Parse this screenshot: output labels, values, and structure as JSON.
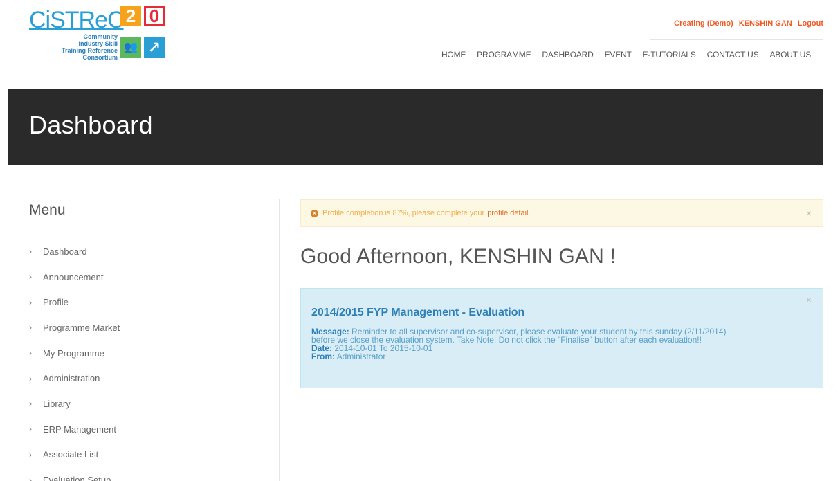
{
  "logo": {
    "word": "CiSTReC",
    "two": "2",
    "zero": "0",
    "sub_lines": [
      "Community",
      "Industry Skill",
      "Training Reference",
      "Consortium"
    ]
  },
  "topbar": {
    "creating": "Creating (Demo)",
    "user": "KENSHIN GAN",
    "logout": "Logout"
  },
  "nav": [
    "HOME",
    "PROGRAMME",
    "DASHBOARD",
    "EVENT",
    "E-TUTORIALS",
    "CONTACT US",
    "ABOUT US"
  ],
  "banner": {
    "title": "Dashboard"
  },
  "sidebar": {
    "title": "Menu",
    "items": [
      "Dashboard",
      "Announcement",
      "Profile",
      "Programme Market",
      "My Programme",
      "Administration",
      "Library",
      "ERP Management",
      "Associate List",
      "Evaluation Setup"
    ]
  },
  "alert_profile": {
    "text": "Profile completion is 87%, please complete your",
    "link": "profile detail.",
    "close": "×"
  },
  "greeting": "Good Afternoon, KENSHIN GAN !",
  "announcement": {
    "title": "2014/2015 FYP Management - Evaluation",
    "message_label": "Message:",
    "message_line1": "Reminder to all supervisor and co-supervisor, please evaluate your student by this sunday (2/11/2014)",
    "message_line2": "before we close the evaluation system. Take Note: Do not click the \"Finalise\" button after each evaluation!!",
    "date_label": "Date:",
    "date_value": "2014-10-01 To 2015-10-01",
    "from_label": "From:",
    "from_value": "Administrator",
    "close": "×"
  },
  "colors": {
    "accent": "#f05a24",
    "banner": "#2a2a2a",
    "info_bg": "#d9edf7",
    "warn_bg": "#fcf8e3"
  }
}
